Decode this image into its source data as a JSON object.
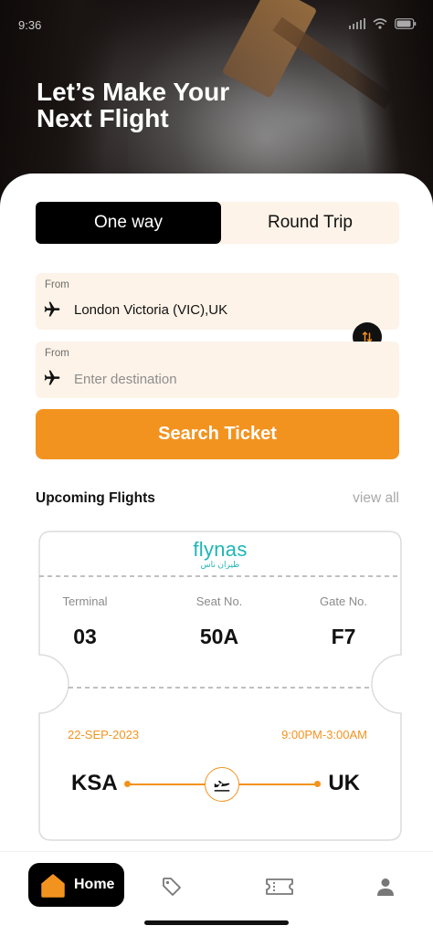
{
  "status_bar": {
    "time": "9:36"
  },
  "hero": {
    "title_line1": "Let’s Make Your",
    "title_line2": "Next Flight"
  },
  "trip_toggle": {
    "one_way": "One way",
    "round_trip": "Round Trip",
    "selected": "One way"
  },
  "from_field": {
    "label": "From",
    "value": "London Victoria (VIC),UK",
    "icon": "airplane-icon"
  },
  "to_field": {
    "label": "From",
    "placeholder": "Enter destination",
    "icon": "airplane-icon"
  },
  "swap": {
    "icon": "swap-vertical-icon"
  },
  "search_button": {
    "label": "Search Ticket"
  },
  "upcoming": {
    "title": "Upcoming Flights",
    "view_all": "view all",
    "ticket": {
      "airline": "flynas",
      "airline_arabic": "طيران ناس",
      "columns": [
        {
          "label": "Terminal",
          "value": "03"
        },
        {
          "label": "Seat No.",
          "value": "50A"
        },
        {
          "label": "Gate No.",
          "value": "F7"
        }
      ],
      "date": "22-SEP-2023",
      "time": "9:00PM-3:00AM",
      "origin": "KSA",
      "destination": "UK"
    }
  },
  "bottom_nav": {
    "home_label": "Home",
    "items": [
      "home-icon",
      "tag-icon",
      "ticket-icon",
      "profile-icon"
    ]
  },
  "colors": {
    "accent": "#f3931f",
    "cream": "#fdf3e8",
    "brand_teal": "#1fb5b5",
    "dark": "#000000"
  }
}
